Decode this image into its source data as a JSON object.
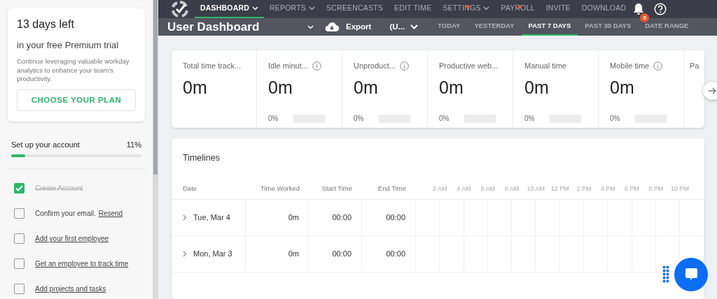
{
  "trial": {
    "title": "13 days left",
    "subtitle": "in your free Premium trial",
    "description": "Continue leveraging valuable workday analytics to enhance your team's productivity.",
    "button": "CHOOSE YOUR PLAN"
  },
  "setup": {
    "title": "Set up your account",
    "percent": "11%",
    "level": 0.11
  },
  "tasks": [
    {
      "label": "Create Account",
      "checked": true,
      "kind": "plain"
    },
    {
      "label": "Confirm your email.",
      "checked": false,
      "kind": "plain",
      "action": "Resend"
    },
    {
      "label": "Add your first employee",
      "checked": false,
      "kind": "link"
    },
    {
      "label": "Get an employee to track time",
      "checked": false,
      "kind": "link"
    },
    {
      "label": "Add projects and tasks",
      "checked": false,
      "kind": "link"
    }
  ],
  "nav": {
    "items": [
      {
        "label": "DASHBOARD",
        "selected": true,
        "dropdown": true,
        "dot": false
      },
      {
        "label": "REPORTS",
        "selected": false,
        "dropdown": true,
        "dot": false
      },
      {
        "label": "SCREENCASTS",
        "selected": false,
        "dropdown": false,
        "dot": false
      },
      {
        "label": "EDIT TIME",
        "selected": false,
        "dropdown": false,
        "dot": false
      },
      {
        "label": "SETTINGS",
        "selected": false,
        "dropdown": true,
        "dot": true
      },
      {
        "label": "PAYROLL",
        "selected": false,
        "dropdown": false,
        "dot": true
      },
      {
        "label": "INVITE",
        "selected": false,
        "dropdown": false,
        "dot": false
      },
      {
        "label": "DOWNLOAD",
        "selected": false,
        "dropdown": false,
        "dot": false
      }
    ],
    "notifications": "5"
  },
  "subheader": {
    "title": "User Dashboard",
    "export": "Export",
    "user": "(U...",
    "ranges": [
      {
        "label": "TODAY",
        "selected": false
      },
      {
        "label": "YESTERDAY",
        "selected": false
      },
      {
        "label": "PAST 7 DAYS",
        "selected": true
      },
      {
        "label": "PAST 30 DAYS",
        "selected": false
      },
      {
        "label": "DATE RANGE",
        "selected": false
      }
    ]
  },
  "stats": [
    {
      "label": "Total time track...",
      "value": "0m",
      "info": false
    },
    {
      "label": "Idle minut...",
      "value": "0m",
      "percent": "0%",
      "info": true
    },
    {
      "label": "Unproduct...",
      "value": "0m",
      "percent": "0%",
      "info": true
    },
    {
      "label": "Productive web...",
      "value": "0m",
      "percent": "0%",
      "info": false
    },
    {
      "label": "Manual time",
      "value": "0m",
      "percent": "0%",
      "info": false
    },
    {
      "label": "Mobile time",
      "value": "0m",
      "percent": "0%",
      "info": true
    },
    {
      "label": "Pa"
    }
  ],
  "timelines": {
    "title": "Timelines",
    "columns": [
      "Date",
      "Time Worked",
      "Start Time",
      "End Time"
    ],
    "hours": [
      "2 AM",
      "4 AM",
      "6 AM",
      "8 AM",
      "10 AM",
      "12 PM",
      "2 PM",
      "4 PM",
      "6 PM",
      "8 PM",
      "10 PM"
    ],
    "rows": [
      {
        "date": "Tue, Mar 4",
        "worked": "0m",
        "start": "00:00",
        "end": "00:00"
      },
      {
        "date": "Mon, Mar 3",
        "worked": "0m",
        "start": "00:00",
        "end": "00:00"
      }
    ]
  }
}
